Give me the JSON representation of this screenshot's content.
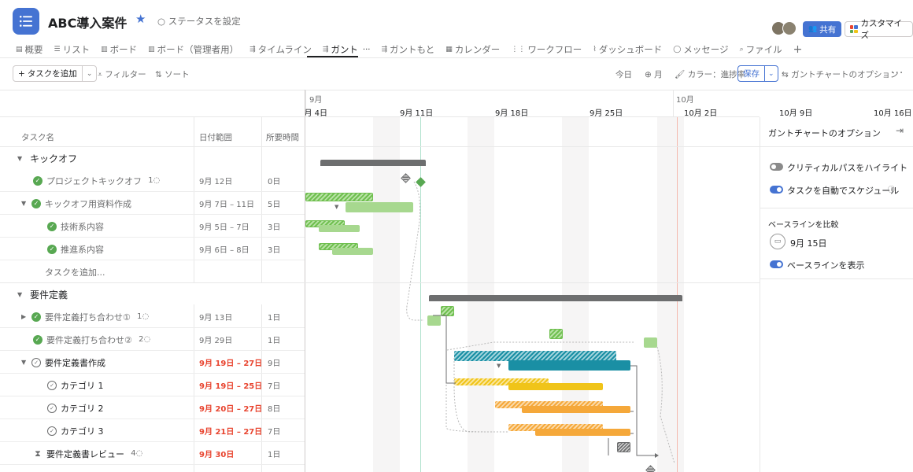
{
  "project": {
    "title": "ABC導入案件",
    "status_label": "ステータスを設定"
  },
  "header": {
    "share_label": "共有",
    "customize_label": "カスタマイズ"
  },
  "tabs": [
    {
      "label": "概要",
      "icon": "overview-icon"
    },
    {
      "label": "リスト",
      "icon": "list-icon"
    },
    {
      "label": "ボード",
      "icon": "board-icon"
    },
    {
      "label": "ボード（管理者用）",
      "icon": "board-icon"
    },
    {
      "label": "タイムライン",
      "icon": "timeline-icon"
    },
    {
      "label": "ガント",
      "icon": "gantt-icon",
      "active": true
    },
    {
      "label": "ガントもと",
      "icon": "gantt-icon"
    },
    {
      "label": "カレンダー",
      "icon": "calendar-icon"
    },
    {
      "label": "ワークフロー",
      "icon": "workflow-icon"
    },
    {
      "label": "ダッシュボード",
      "icon": "dashboard-icon"
    },
    {
      "label": "メッセージ",
      "icon": "message-icon"
    },
    {
      "label": "ファイル",
      "icon": "file-icon"
    }
  ],
  "toolbar": {
    "add_task": "タスクを追加",
    "filter": "フィルター",
    "sort": "ソート",
    "today": "今日",
    "zoom": "月",
    "color": "カラー：進捗率",
    "save": "保存",
    "gantt_options": "ガントチャートのオプション"
  },
  "timeline": {
    "months": [
      "9月",
      "10月"
    ],
    "dates": [
      "9月 4日",
      "9月 11日",
      "9月 18日",
      "9月 25日",
      "10月 2日",
      "10月 9日",
      "10月 16日"
    ]
  },
  "table": {
    "columns": {
      "name": "タスク名",
      "date": "日付範囲",
      "duration": "所要時間"
    },
    "sections": [
      {
        "name": "キックオフ",
        "rows": [
          {
            "name": "プロジェクトキックオフ",
            "comments": "1",
            "date": "9月 12日",
            "duration": "0日"
          },
          {
            "name": "キックオフ用資料作成",
            "date": "9月 7日 – 11日",
            "duration": "5日"
          },
          {
            "name": "技術系内容",
            "date": "9月 5日 – 7日",
            "duration": "3日"
          },
          {
            "name": "推進系内容",
            "date": "9月 6日 – 8日",
            "duration": "3日"
          }
        ],
        "add_task": "タスクを追加..."
      },
      {
        "name": "要件定義",
        "rows": [
          {
            "name": "要件定義打ち合わせ①",
            "comments": "1",
            "date": "9月 13日",
            "duration": "1日"
          },
          {
            "name": "要件定義打ち合わせ②",
            "comments": "2",
            "date": "9月 29日",
            "duration": "1日"
          },
          {
            "name": "要件定義書作成",
            "date": "9月 19日 – 27日",
            "duration": "9日"
          },
          {
            "name": "カテゴリ 1",
            "date": "9月 19日 – 25日",
            "duration": "7日"
          },
          {
            "name": "カテゴリ 2",
            "date": "9月 20日 – 27日",
            "duration": "8日"
          },
          {
            "name": "カテゴリ 3",
            "date": "9月 21日 – 27日",
            "duration": "7日"
          },
          {
            "name": "要件定義書レビュー",
            "comments": "4",
            "date": "9月 30日",
            "duration": "1日"
          }
        ]
      }
    ]
  },
  "options_panel": {
    "title": "ガントチャートのオプション",
    "critical_path": "クリティカルパスをハイライト",
    "auto_schedule": "タスクを自動でスケジュール",
    "baseline_title": "ベースラインを比較",
    "baseline_date": "9月 15日",
    "show_baseline": "ベースラインを表示"
  },
  "colors": {
    "accent": "#4573d2",
    "done_green": "#58a852",
    "teal": "#1a8fa4",
    "yellow": "#f0c419",
    "orange": "#f5a83a",
    "due_red": "#e8442f"
  }
}
